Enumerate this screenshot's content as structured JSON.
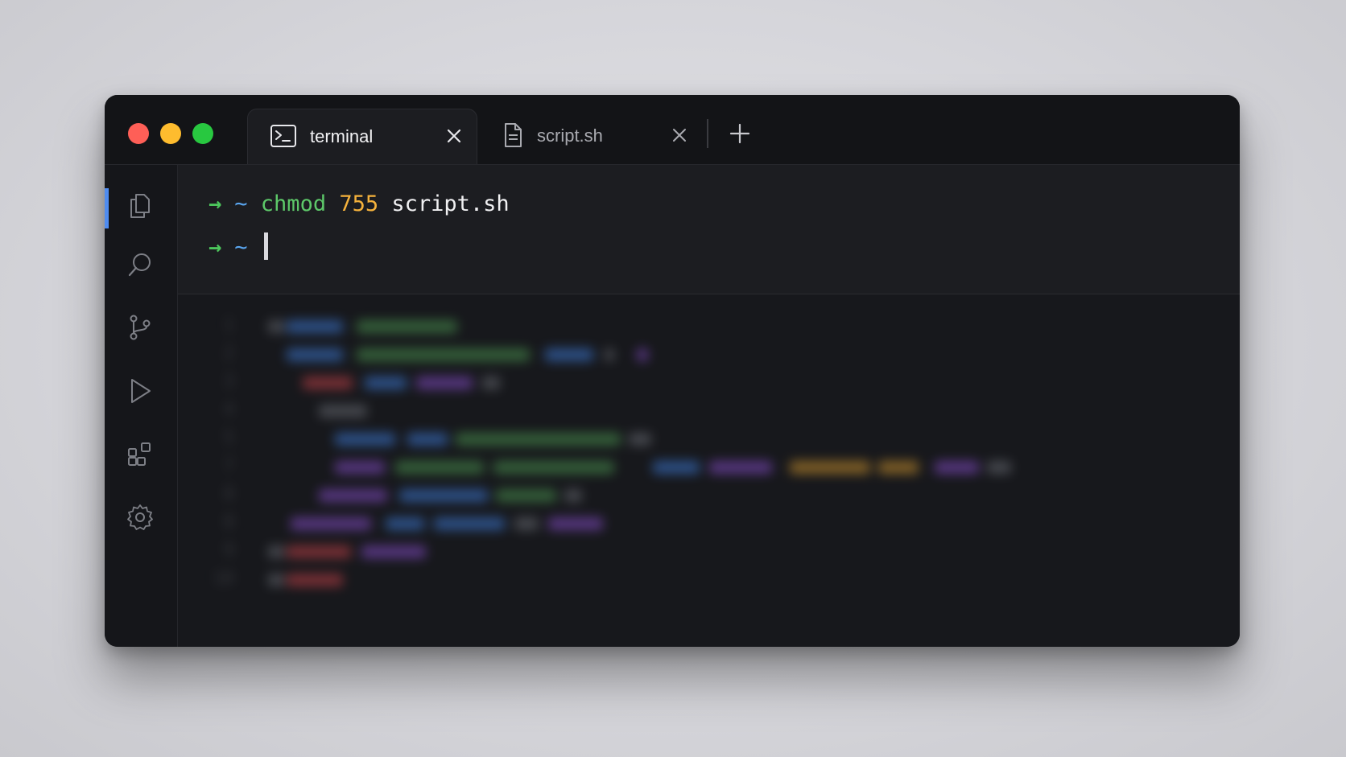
{
  "tabs": [
    {
      "label": "terminal",
      "icon": "terminal-icon",
      "active": true
    },
    {
      "label": "script.sh",
      "icon": "file-icon",
      "active": false
    }
  ],
  "terminal": {
    "line1": {
      "prompt_arrow": "→",
      "cwd": "~",
      "command": "chmod",
      "mode": "755",
      "argument": "script.sh"
    },
    "line2": {
      "prompt_arrow": "→",
      "cwd": "~"
    }
  },
  "sidebar": {
    "items": [
      {
        "icon": "files-icon",
        "active": true
      },
      {
        "icon": "search-icon",
        "active": false
      },
      {
        "icon": "source-control-icon",
        "active": false
      },
      {
        "icon": "run-icon",
        "active": false
      },
      {
        "icon": "extensions-icon",
        "active": false
      },
      {
        "icon": "settings-icon",
        "active": false
      }
    ]
  },
  "editor": {
    "line_numbers": [
      "1",
      "2",
      "3",
      "4",
      "5",
      "7",
      "8",
      "8",
      "9",
      "10"
    ]
  },
  "colors": {
    "accent": "#4f8cf0",
    "prompt_arrow": "#4cc65c",
    "cwd": "#5aa6f0",
    "command": "#5dc869",
    "number": "#f5b23c",
    "window_bg": "#17181c"
  }
}
